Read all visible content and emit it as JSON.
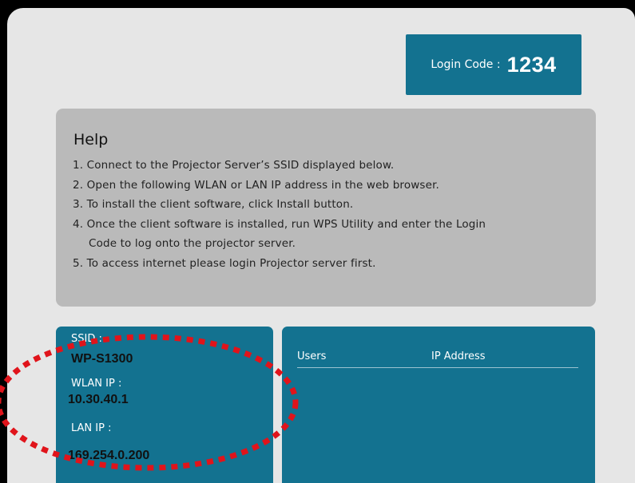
{
  "login": {
    "label": "Login Code :",
    "code": "1234"
  },
  "help": {
    "title": "Help",
    "items": [
      "1. Connect to the Projector Server’s SSID displayed below.",
      "2. Open the following WLAN or LAN IP address in the web browser.",
      "3. To install the client software, click Install button.",
      "4. Once the client software is installed, run WPS Utility and enter the Login",
      "Code to log onto the projector server.",
      "5. To access internet please login Projector server first."
    ]
  },
  "network": {
    "ssid_label": "SSID :",
    "ssid": "WP-S1300",
    "wlan_label": "WLAN IP :",
    "wlan_ip": "10.30.40.1",
    "lan_label": "LAN IP :",
    "lan_ip": "169.254.0.200"
  },
  "users_table": {
    "col_users": "Users",
    "col_ip": "IP Address",
    "rows": []
  },
  "colors": {
    "panel": "#137290",
    "help_panel": "#bababa",
    "background": "#e6e6e6",
    "annotation": "#e0141b"
  }
}
